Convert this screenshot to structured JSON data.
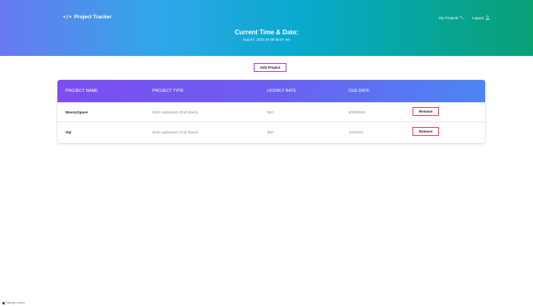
{
  "header": {
    "brand_symbol": "</>",
    "brand_name": "Project Tracker",
    "nav": {
      "my_projects": "My Projects",
      "my_projects_icon": "terminal-icon",
      "logout": "Logout",
      "logout_icon": "user-icon"
    },
    "title": "Current Time & Date:",
    "datetime": "Aug 07, 2022 at 08:48:47 am"
  },
  "toolbar": {
    "add_label": "Add Project"
  },
  "table": {
    "columns": [
      "PROJECT NAME",
      "PROJECT TYPE",
      "HOURLY RATE",
      "DUE DATE"
    ],
    "rows": [
      {
        "name": "MoovySpace",
        "type": "Web Application (Full Stack)",
        "rate": "$10",
        "due": "8/06/2022",
        "action": "Remove"
      },
      {
        "name": "Sqr",
        "type": "Web Application (Full Stack)",
        "rate": "$20",
        "due": "1/4/2023",
        "action": "Remove"
      }
    ]
  },
  "footer": {
    "text": "Manage cookies"
  },
  "colors": {
    "header_gradient_start": "#6a79f0",
    "header_gradient_end": "#0b9f74",
    "table_header_start": "#7c4df0",
    "table_header_end": "#4b86f3",
    "add_button_border": "#b13dd4",
    "remove_button_border": "#e0454f"
  }
}
